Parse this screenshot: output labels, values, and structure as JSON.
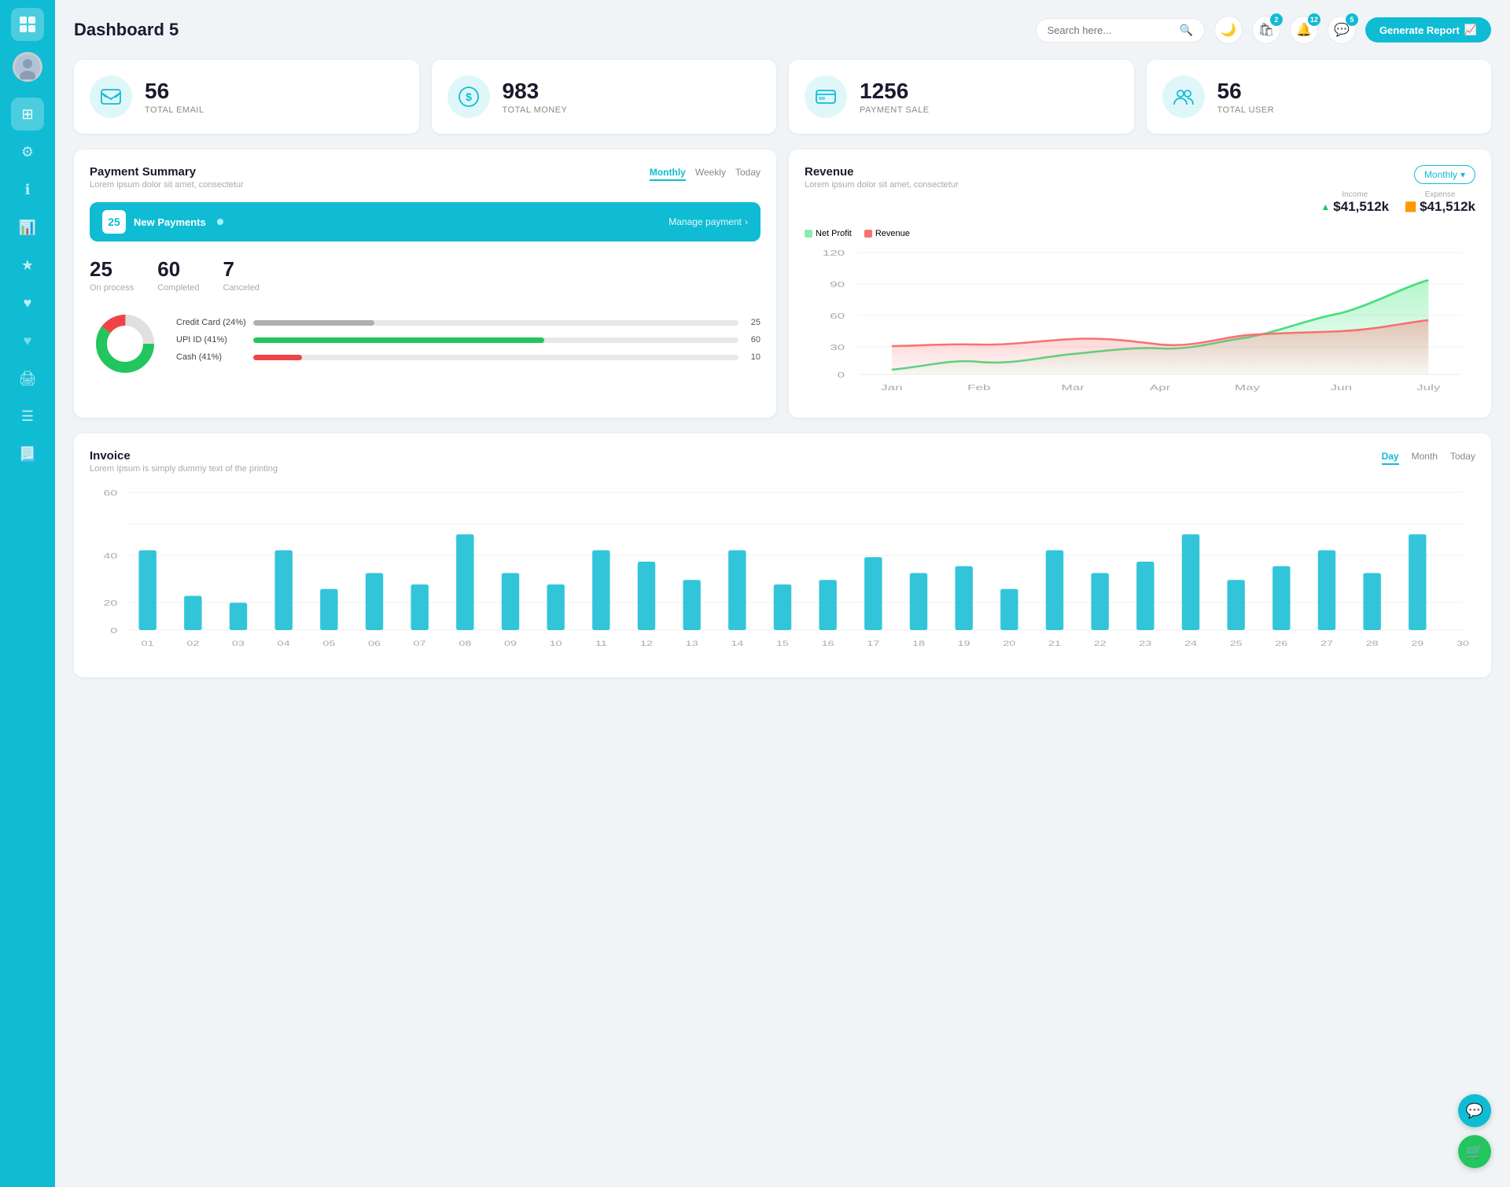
{
  "app": {
    "title": "Dashboard 5"
  },
  "header": {
    "search_placeholder": "Search here...",
    "generate_btn": "Generate Report",
    "badge_cart": "2",
    "badge_bell": "12",
    "badge_chat": "5"
  },
  "stats": [
    {
      "id": "total-email",
      "number": "56",
      "label": "TOTAL EMAIL",
      "icon": "📋"
    },
    {
      "id": "total-money",
      "number": "983",
      "label": "TOTAL MONEY",
      "icon": "💲"
    },
    {
      "id": "payment-sale",
      "number": "1256",
      "label": "PAYMENT SALE",
      "icon": "🧾"
    },
    {
      "id": "total-user",
      "number": "56",
      "label": "TOTAL USER",
      "icon": "👥"
    }
  ],
  "payment_summary": {
    "title": "Payment Summary",
    "subtitle": "Lorem ipsum dolor sit amet, consectetur",
    "tabs": [
      "Monthly",
      "Weekly",
      "Today"
    ],
    "active_tab": "Monthly",
    "new_payments_count": "25",
    "new_payments_label": "New Payments",
    "manage_link": "Manage payment",
    "on_process": "25",
    "on_process_label": "On process",
    "completed": "60",
    "completed_label": "Completed",
    "canceled": "7",
    "canceled_label": "Canceled",
    "bars": [
      {
        "label": "Credit Card (24%)",
        "value": 25,
        "pct": 25,
        "color": "#b0b0b0"
      },
      {
        "label": "UPI ID (41%)",
        "value": 60,
        "pct": 60,
        "color": "#22c55e"
      },
      {
        "label": "Cash (41%)",
        "value": 10,
        "pct": 10,
        "color": "#ef4444"
      }
    ]
  },
  "revenue": {
    "title": "Revenue",
    "subtitle": "Lorem ipsum dolor sit amet, consectetur",
    "active_tab": "Monthly",
    "income_label": "Income",
    "income_value": "$41,512k",
    "expense_label": "Expense",
    "expense_value": "$41,512k",
    "legend": [
      {
        "label": "Net Profit",
        "color": "#86efac"
      },
      {
        "label": "Revenue",
        "color": "#f87171"
      }
    ],
    "x_labels": [
      "Jan",
      "Feb",
      "Mar",
      "Apr",
      "May",
      "Jun",
      "July"
    ],
    "y_labels": [
      "0",
      "30",
      "60",
      "90",
      "120"
    ],
    "net_profit_data": [
      5,
      15,
      20,
      25,
      35,
      60,
      95
    ],
    "revenue_data": [
      28,
      32,
      38,
      30,
      40,
      45,
      55
    ]
  },
  "invoice": {
    "title": "Invoice",
    "subtitle": "Lorem Ipsum is simply dummy text of the printing",
    "tabs": [
      "Day",
      "Month",
      "Today"
    ],
    "active_tab": "Day",
    "y_labels": [
      "0",
      "20",
      "40",
      "60"
    ],
    "x_labels": [
      "01",
      "02",
      "03",
      "04",
      "05",
      "06",
      "07",
      "08",
      "09",
      "10",
      "11",
      "12",
      "13",
      "14",
      "15",
      "16",
      "17",
      "18",
      "19",
      "20",
      "21",
      "22",
      "23",
      "24",
      "25",
      "26",
      "27",
      "28",
      "29",
      "30"
    ],
    "bar_data": [
      35,
      15,
      12,
      35,
      18,
      25,
      20,
      42,
      25,
      20,
      35,
      30,
      22,
      35,
      20,
      22,
      32,
      25,
      28,
      18,
      35,
      25,
      30,
      42,
      22,
      28,
      35,
      25,
      42,
      32
    ]
  },
  "sidebar": {
    "items": [
      {
        "id": "wallet",
        "icon": "💼",
        "active": true
      },
      {
        "id": "dashboard",
        "icon": "⊞",
        "active": true
      },
      {
        "id": "settings",
        "icon": "⚙",
        "active": false
      },
      {
        "id": "info",
        "icon": "ℹ",
        "active": false
      },
      {
        "id": "chart",
        "icon": "📊",
        "active": false
      },
      {
        "id": "star",
        "icon": "★",
        "active": false
      },
      {
        "id": "heart1",
        "icon": "♥",
        "active": false
      },
      {
        "id": "heart2",
        "icon": "♥",
        "active": false
      },
      {
        "id": "print",
        "icon": "🖨",
        "active": false
      },
      {
        "id": "menu",
        "icon": "☰",
        "active": false
      },
      {
        "id": "list",
        "icon": "📃",
        "active": false
      }
    ]
  },
  "fab": {
    "support_icon": "💬",
    "cart_icon": "🛒"
  }
}
